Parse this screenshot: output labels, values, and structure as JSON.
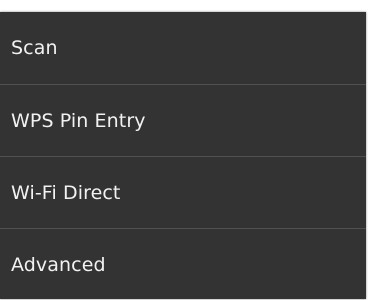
{
  "menu": {
    "items": [
      {
        "label": "Scan"
      },
      {
        "label": "WPS Pin Entry"
      },
      {
        "label": "Wi-Fi Direct"
      },
      {
        "label": "Advanced"
      }
    ]
  }
}
